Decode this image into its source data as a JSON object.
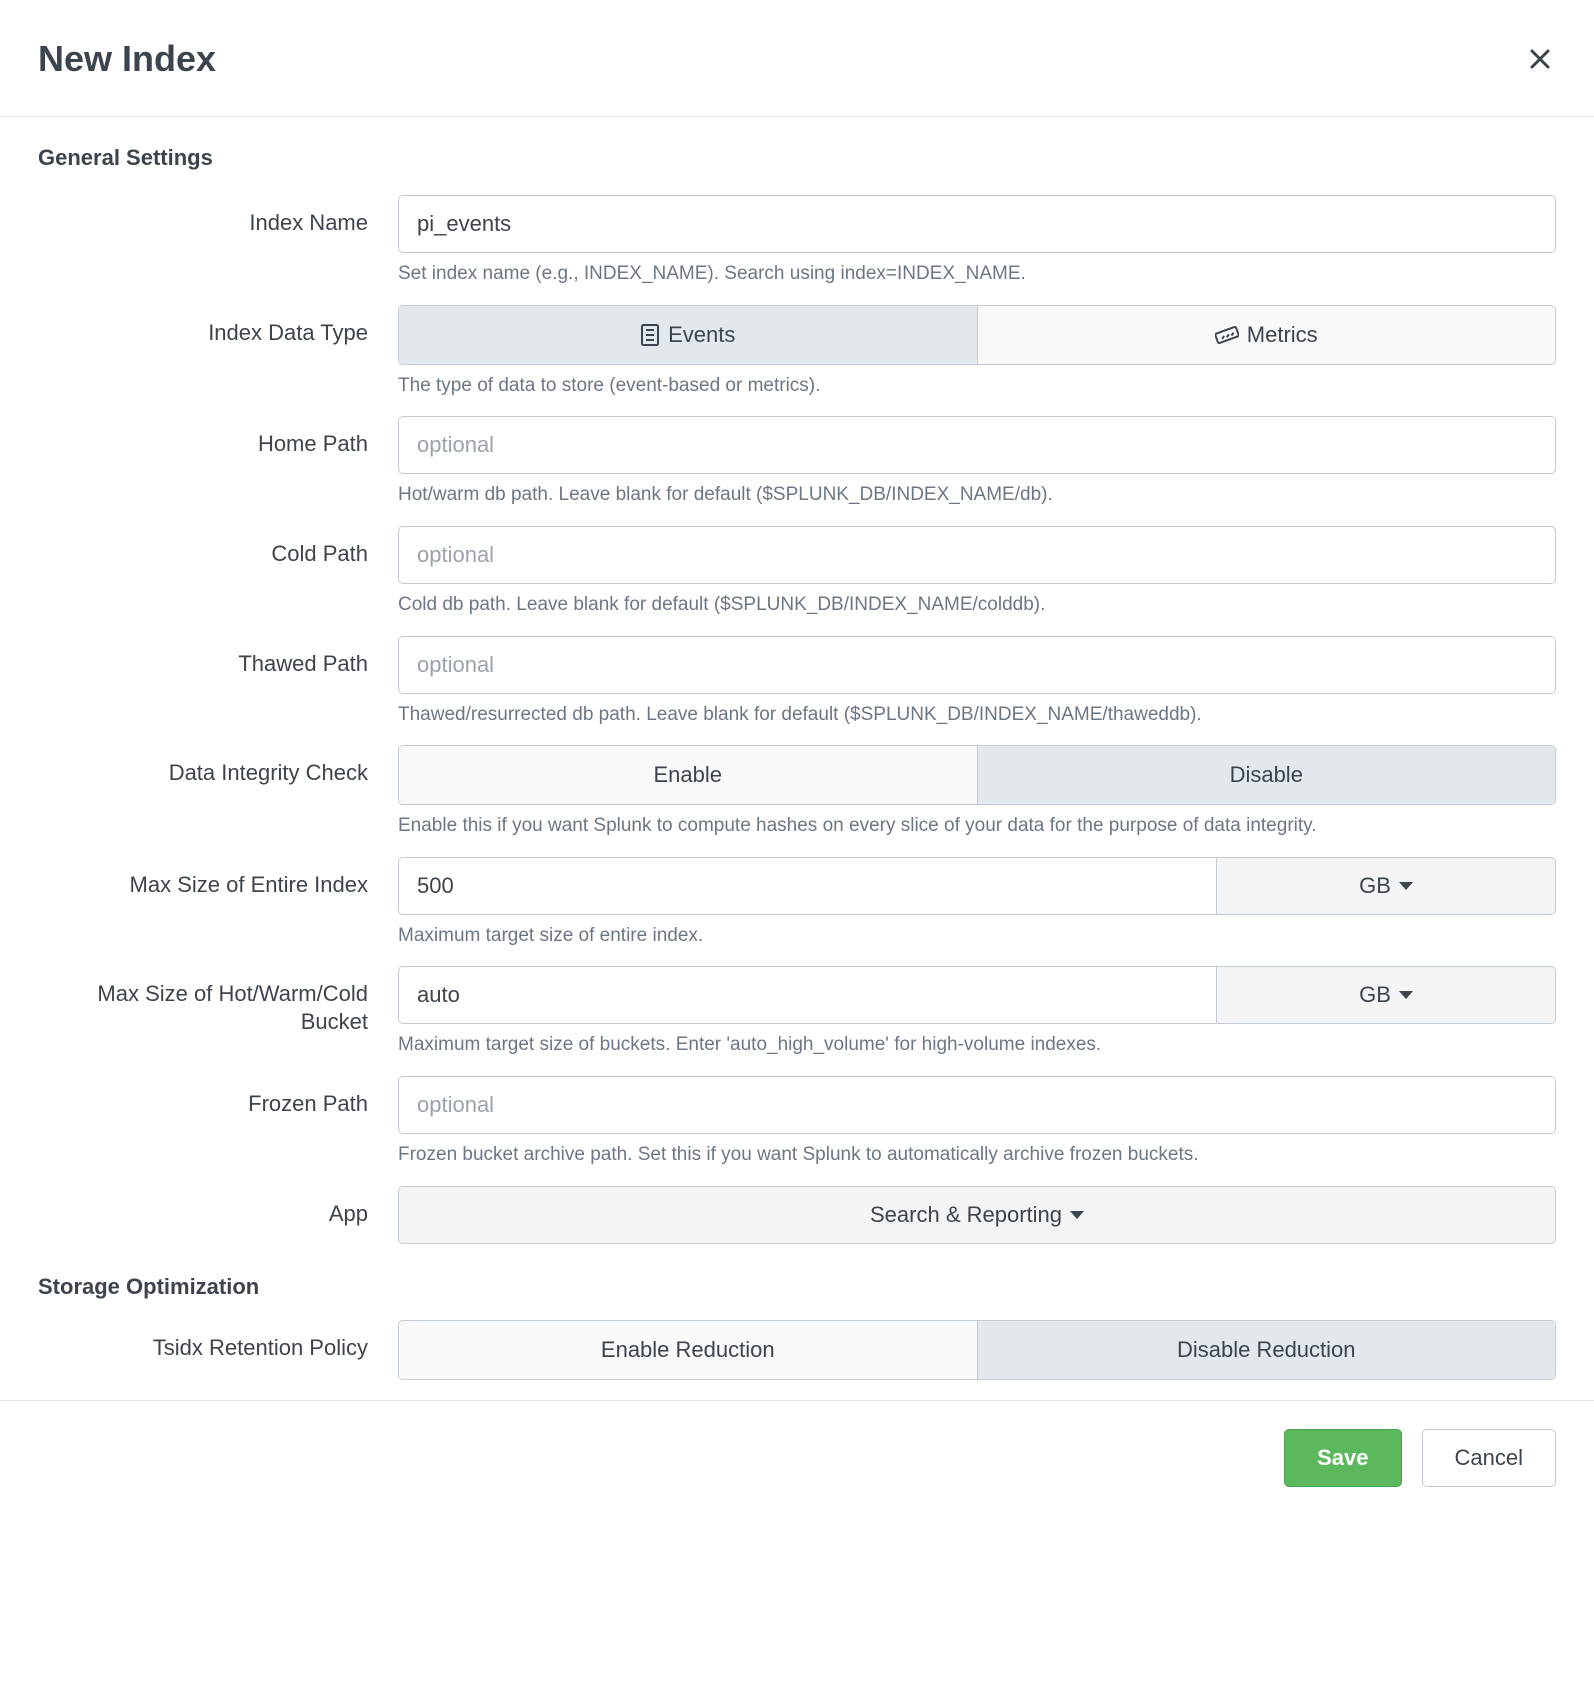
{
  "modal": {
    "title": "New Index"
  },
  "sections": {
    "general": "General Settings",
    "storage": "Storage Optimization"
  },
  "fields": {
    "indexName": {
      "label": "Index Name",
      "value": "pi_events",
      "help": "Set index name (e.g., INDEX_NAME). Search using index=INDEX_NAME."
    },
    "dataType": {
      "label": "Index Data Type",
      "events": "Events",
      "metrics": "Metrics",
      "help": "The type of data to store (event-based or metrics)."
    },
    "homePath": {
      "label": "Home Path",
      "placeholder": "optional",
      "help": "Hot/warm db path. Leave blank for default ($SPLUNK_DB/INDEX_NAME/db)."
    },
    "coldPath": {
      "label": "Cold Path",
      "placeholder": "optional",
      "help": "Cold db path. Leave blank for default ($SPLUNK_DB/INDEX_NAME/colddb)."
    },
    "thawedPath": {
      "label": "Thawed Path",
      "placeholder": "optional",
      "help": "Thawed/resurrected db path. Leave blank for default ($SPLUNK_DB/INDEX_NAME/thaweddb)."
    },
    "integrity": {
      "label": "Data Integrity Check",
      "enable": "Enable",
      "disable": "Disable",
      "help": "Enable this if you want Splunk to compute hashes on every slice of your data for the purpose of data integrity."
    },
    "maxIndexSize": {
      "label": "Max Size of Entire Index",
      "value": "500",
      "unit": "GB",
      "help": "Maximum target size of entire index."
    },
    "maxBucketSize": {
      "label": "Max Size of Hot/Warm/Cold Bucket",
      "value": "auto",
      "unit": "GB",
      "help": "Maximum target size of buckets. Enter 'auto_high_volume' for high-volume indexes."
    },
    "frozenPath": {
      "label": "Frozen Path",
      "placeholder": "optional",
      "help": "Frozen bucket archive path. Set this if you want Splunk to automatically archive frozen buckets."
    },
    "app": {
      "label": "App",
      "value": "Search & Reporting"
    },
    "tsidx": {
      "label": "Tsidx Retention Policy",
      "enable": "Enable Reduction",
      "disable": "Disable Reduction"
    }
  },
  "footer": {
    "save": "Save",
    "cancel": "Cancel"
  }
}
